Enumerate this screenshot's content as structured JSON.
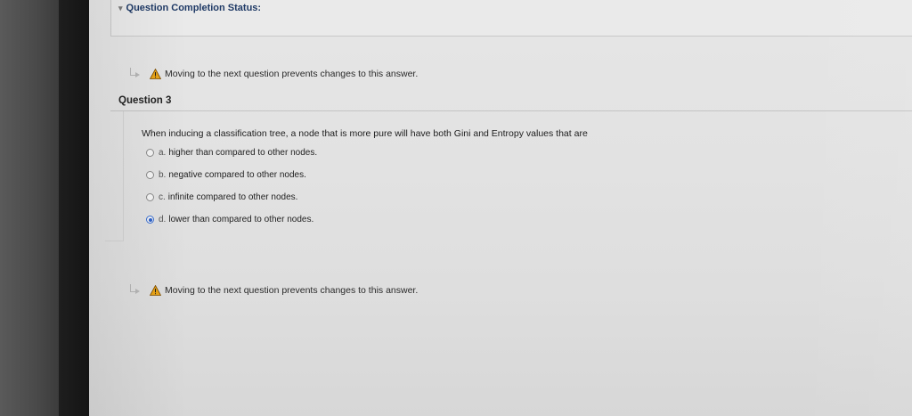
{
  "status": {
    "chevron": "▾",
    "title": "Question Completion Status:"
  },
  "warning_top": "Moving to the next question prevents changes to this answer.",
  "question": {
    "label": "Question 3",
    "prompt": "When inducing a classification tree, a node that is more pure will have both Gini and Entropy values that are",
    "options": [
      {
        "letter": "a.",
        "text": "higher than compared to other nodes.",
        "selected": false
      },
      {
        "letter": "b.",
        "text": "negative compared to other nodes.",
        "selected": false
      },
      {
        "letter": "c.",
        "text": "infinite compared to other nodes.",
        "selected": false
      },
      {
        "letter": "d.",
        "text": "lower than compared to other nodes.",
        "selected": true
      }
    ]
  },
  "warning_bottom": "Moving to the next question prevents changes to this answer.",
  "colors": {
    "title": "#1f3a66",
    "selected_radio": "#2f62c8",
    "warning_triangle": "#e8a317"
  },
  "icons": {
    "chevron": "chevron-down-icon",
    "arrow": "return-arrow-icon",
    "warning": "warning-icon"
  }
}
